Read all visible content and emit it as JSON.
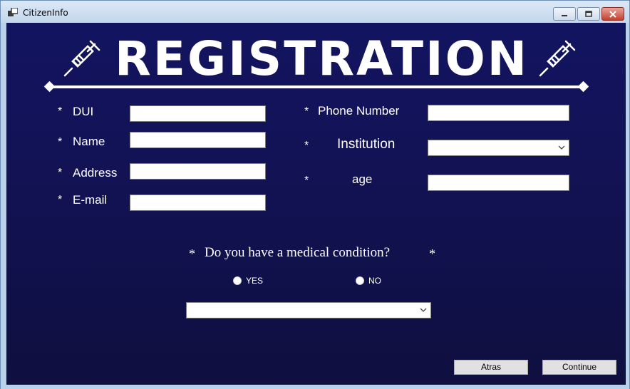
{
  "window": {
    "title": "CitizenInfo"
  },
  "header": {
    "title": "REGISTRATION"
  },
  "form": {
    "required_marker": "*",
    "left_fields": [
      {
        "label": "DUI",
        "value": ""
      },
      {
        "label": "Name",
        "value": ""
      },
      {
        "label": "Address",
        "value": ""
      },
      {
        "label": "E-mail",
        "value": ""
      }
    ],
    "right_fields": {
      "phone": {
        "label": "Phone Number",
        "value": ""
      },
      "institution": {
        "label": "Institution",
        "selected": ""
      },
      "age": {
        "label": "age",
        "value": ""
      }
    },
    "medical": {
      "question": "Do you have a medical condition?",
      "yes_label": "YES",
      "no_label": "NO",
      "selected": ""
    }
  },
  "buttons": {
    "back_label": "Atras",
    "continue_label": "Continue"
  },
  "colors": {
    "background_top": "#131460",
    "background_bottom": "#0f0f40",
    "text": "#ffffff"
  }
}
